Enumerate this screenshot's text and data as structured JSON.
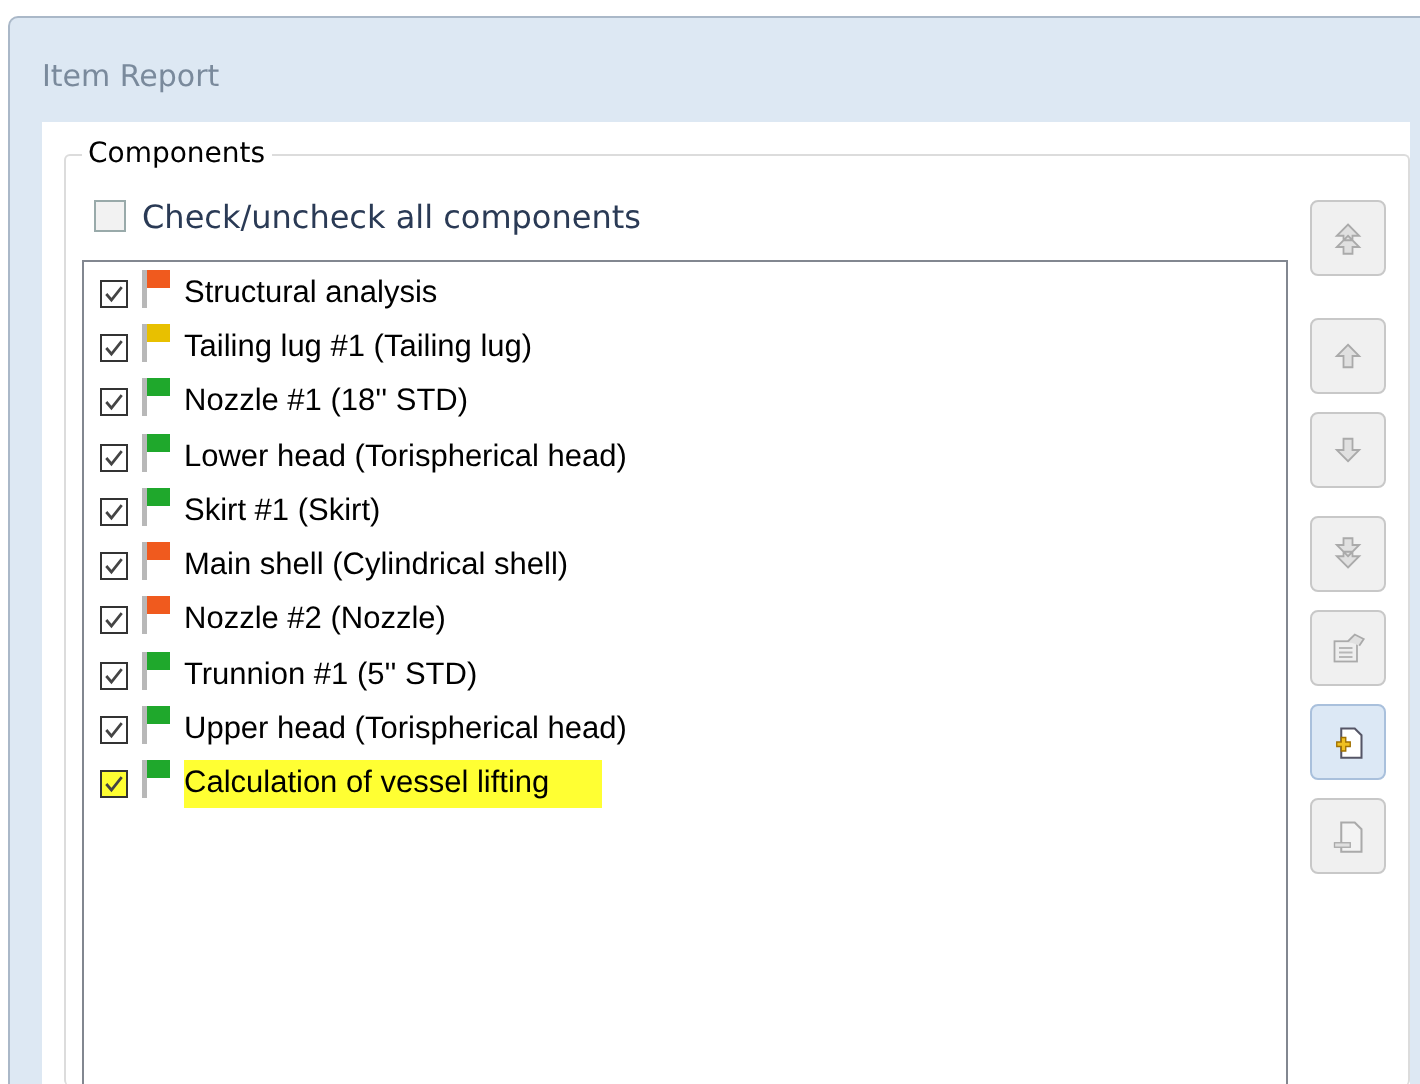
{
  "window": {
    "title": "Item Report"
  },
  "components": {
    "title": "Components",
    "check_all": {
      "label": "Check/uncheck all components",
      "checked": false
    },
    "items": [
      {
        "label": "Structural analysis",
        "checked": true,
        "color": "#f05a1e",
        "highlighted": false
      },
      {
        "label": "Tailing lug #1 (Tailing lug)",
        "checked": true,
        "color": "#e8c000",
        "highlighted": false
      },
      {
        "label": "Nozzle #1 (18'' STD)",
        "checked": true,
        "color": "#1fa82c",
        "highlighted": false
      },
      {
        "label": "Lower head (Torispherical head)",
        "checked": true,
        "color": "#1fa82c",
        "highlighted": false
      },
      {
        "label": "Skirt #1 (Skirt)",
        "checked": true,
        "color": "#1fa82c",
        "highlighted": false
      },
      {
        "label": "Main shell (Cylindrical shell)",
        "checked": true,
        "color": "#f05a1e",
        "highlighted": false
      },
      {
        "label": "Nozzle #2 (Nozzle)",
        "checked": true,
        "color": "#f05a1e",
        "highlighted": false
      },
      {
        "label": "Trunnion #1 (5'' STD)",
        "checked": true,
        "color": "#1fa82c",
        "highlighted": false
      },
      {
        "label": "Upper head (Torispherical head)",
        "checked": true,
        "color": "#1fa82c",
        "highlighted": false
      },
      {
        "label": "Calculation of vessel lifting",
        "checked": true,
        "color": "#1fa82c",
        "highlighted": true
      }
    ],
    "buttons": [
      {
        "kind": "top",
        "disabled": true
      },
      {
        "kind": "up",
        "disabled": true
      },
      {
        "kind": "down",
        "disabled": true
      },
      {
        "kind": "bottom",
        "disabled": true
      },
      {
        "kind": "properties",
        "disabled": true
      },
      {
        "kind": "add",
        "disabled": false
      },
      {
        "kind": "remove",
        "disabled": true
      }
    ]
  }
}
